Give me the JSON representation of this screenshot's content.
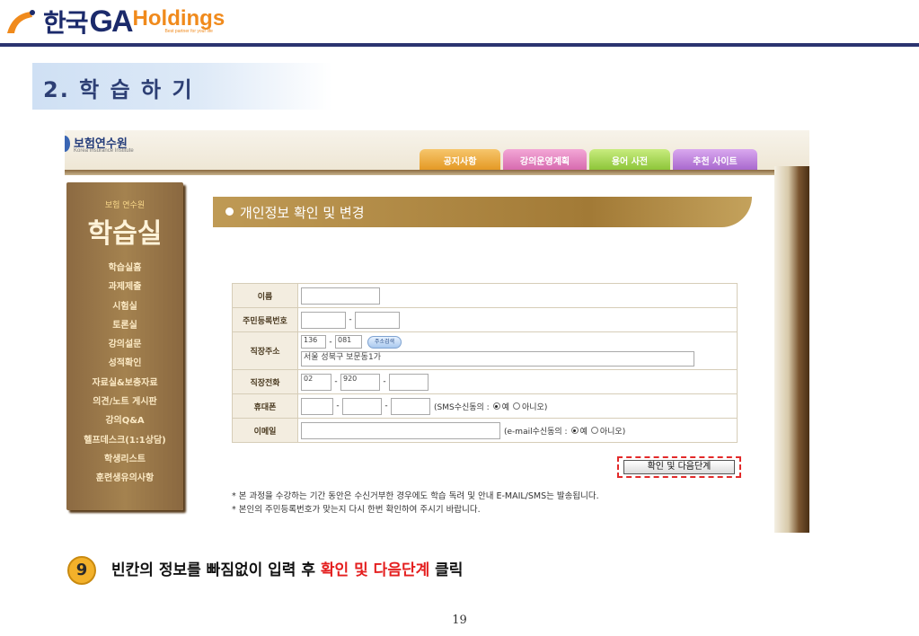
{
  "slide": {
    "logo_korean": "한국",
    "logo_ga": "GA",
    "logo_holdings": "Holdings",
    "logo_tagline": "Best partner for your life",
    "section_title": "2. 학 습 하 기",
    "page_number": "19",
    "brand_colors": {
      "navy": "#2b3470",
      "orange": "#f08a1c"
    }
  },
  "site": {
    "name": "보험연수원",
    "name_en": "Korea Insurance Institute",
    "tabs": [
      "공지사항",
      "강의운영계획",
      "용어 사전",
      "추천 사이트"
    ]
  },
  "sidebar": {
    "subtitle": "보험 연수원",
    "title": "학습실",
    "items": [
      "학습실홈",
      "과제제출",
      "시험실",
      "토론실",
      "강의설문",
      "성적확인",
      "자료실&보충자료",
      "의견/노트 게시판",
      "강의Q&A",
      "헬프데스크(1:1상담)",
      "학생리스트",
      "훈련생유의사항"
    ]
  },
  "content": {
    "banner_title": "개인정보 확인 및 변경",
    "form": {
      "name_label": "이름",
      "rrn_label": "주민등록번호",
      "work_address_label": "직장주소",
      "zip1": "136",
      "zip2": "081",
      "address_search_button": "주소검색",
      "address_value": "서울 성북구 보문동1가",
      "work_phone_label": "직장전화",
      "phone_area": "02",
      "phone_mid": "920",
      "mobile_label": "휴대폰",
      "sms_consent_label": "(SMS수신동의 :",
      "email_label": "이메일",
      "email_consent_label": "(e-mail수신동의 :",
      "yes_label": "예",
      "no_label": "아니오)"
    },
    "next_button": "확인 및 다음단계",
    "notes": [
      "* 본 과정을 수강하는 기간 동안은 수신거부한 경우에도 학습 독려 및 안내 E-MAIL/SMS는 발송됩니다.",
      "* 본인의 주민등록번호가 맞는지 다시 한번 확인하여 주시기 바랍니다."
    ]
  },
  "caption": {
    "step_number": "9",
    "text_before": "빈칸의 정보를 빠짐없이 입력 후 ",
    "highlight": "확인 및 다음단계",
    "text_after": " 클릭",
    "highlight_color": "#e41e1e"
  }
}
